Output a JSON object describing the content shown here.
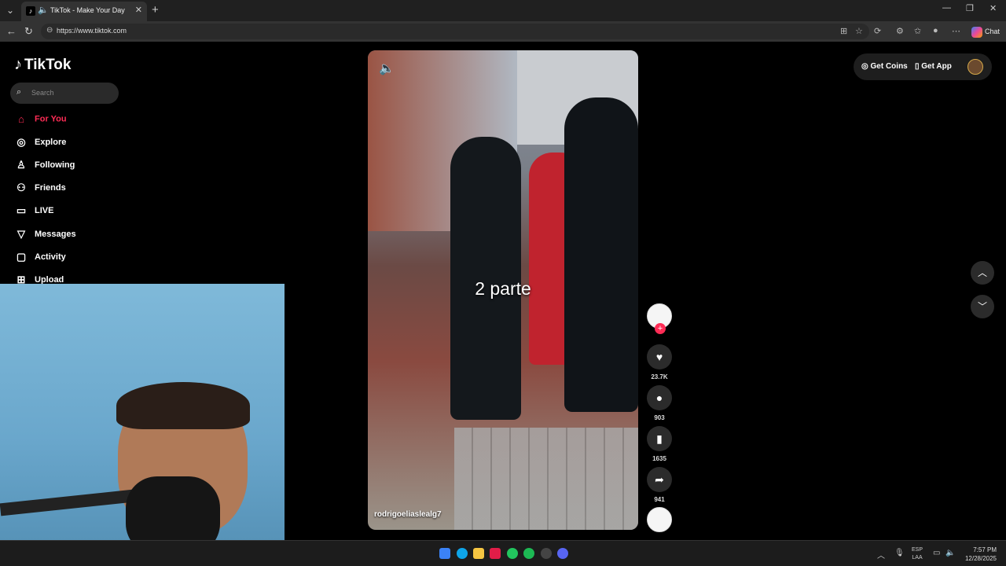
{
  "browser": {
    "tab_title": "TikTok - Make Your Day",
    "url": "https://www.tiktok.com",
    "chat_label": "Chat"
  },
  "tiktok": {
    "logo": "TikTok",
    "search_placeholder": "Search",
    "sidebar": [
      {
        "label": "For You",
        "icon": "home-icon",
        "active": true
      },
      {
        "label": "Explore",
        "icon": "compass-icon"
      },
      {
        "label": "Following",
        "icon": "following-icon"
      },
      {
        "label": "Friends",
        "icon": "friends-icon"
      },
      {
        "label": "LIVE",
        "icon": "live-icon"
      },
      {
        "label": "Messages",
        "icon": "messages-icon"
      },
      {
        "label": "Activity",
        "icon": "activity-icon"
      },
      {
        "label": "Upload",
        "icon": "upload-icon"
      }
    ],
    "top_right": {
      "coins_label": "Get Coins",
      "app_label": "Get App"
    },
    "video": {
      "caption": "2 parte",
      "author": "rodrigoeliaslealg7"
    },
    "actions": {
      "likes": "23.7K",
      "comments": "903",
      "saves": "1635",
      "shares": "941"
    }
  },
  "taskbar": {
    "lang_line1": "ESP",
    "lang_line2": "LAA",
    "time": "7:57 PM",
    "date": "12/28/2025"
  },
  "colors": {
    "accent": "#fe2c55",
    "background": "#000000"
  }
}
